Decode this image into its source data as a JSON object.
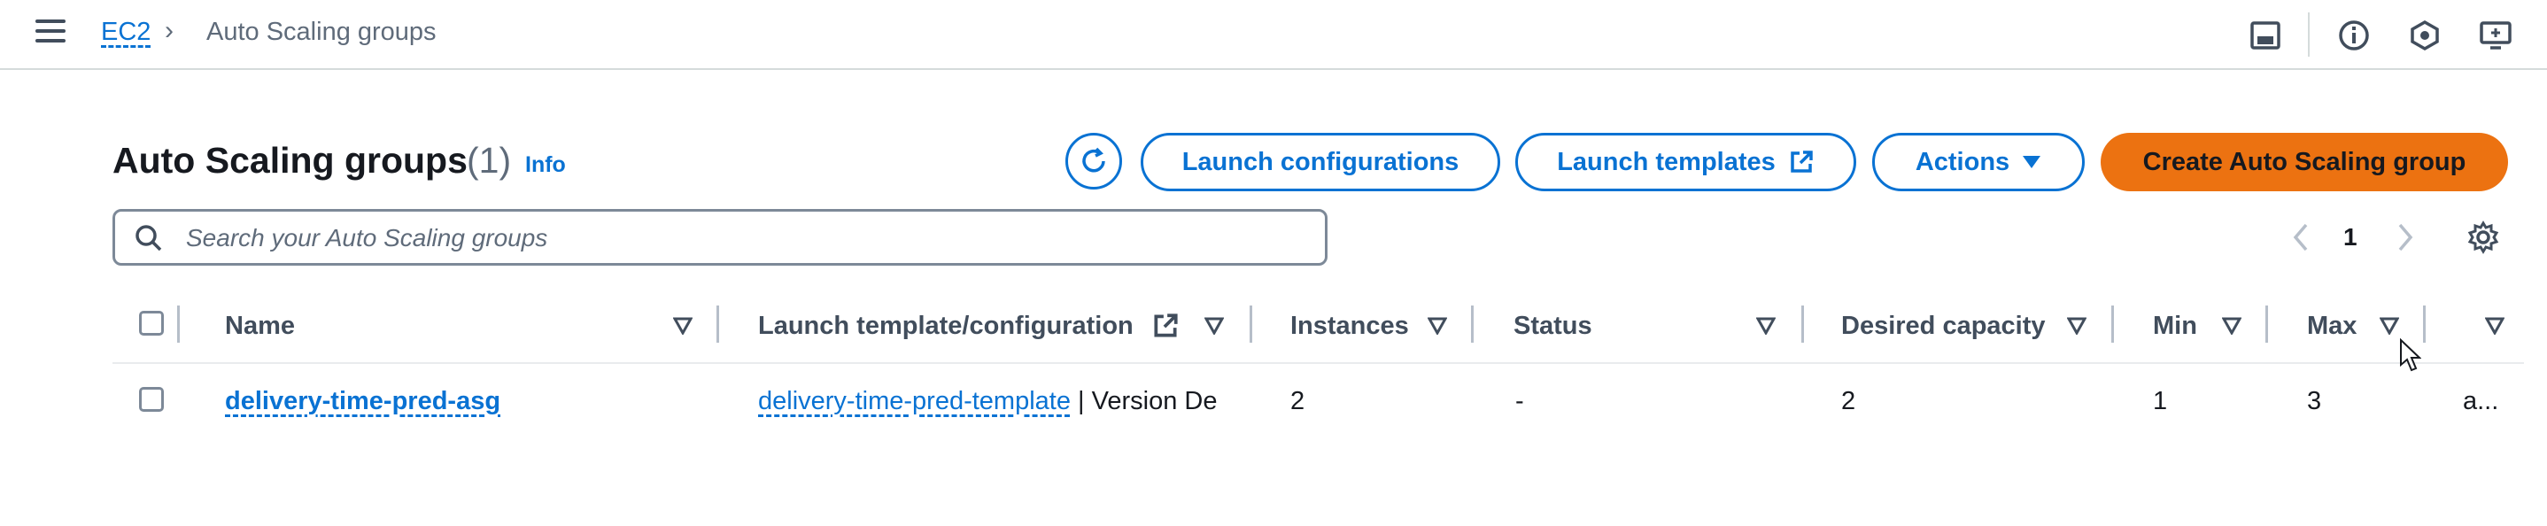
{
  "breadcrumb": {
    "service": "EC2",
    "current": "Auto Scaling groups"
  },
  "header": {
    "title": "Auto Scaling groups",
    "count": "(1)",
    "info": "Info",
    "buttons": {
      "launch_configurations": "Launch configurations",
      "launch_templates": "Launch templates",
      "actions": "Actions",
      "create": "Create Auto Scaling group"
    }
  },
  "search": {
    "placeholder": "Search your Auto Scaling groups",
    "value": ""
  },
  "pagination": {
    "current_page": "1"
  },
  "table": {
    "columns": [
      "Name",
      "Launch template/configuration",
      "Instances",
      "Status",
      "Desired capacity",
      "Min",
      "Max"
    ],
    "rows": [
      {
        "name": "delivery-time-pred-asg",
        "template": "delivery-time-pred-template",
        "template_suffix": "| Version De",
        "instances": "2",
        "status": "-",
        "desired": "2",
        "min": "1",
        "max": "3",
        "extra": "a..."
      }
    ]
  },
  "colors": {
    "link": "#0972d3",
    "primary": "#ec7211",
    "text": "#16191f",
    "muted": "#5f6b7a"
  }
}
